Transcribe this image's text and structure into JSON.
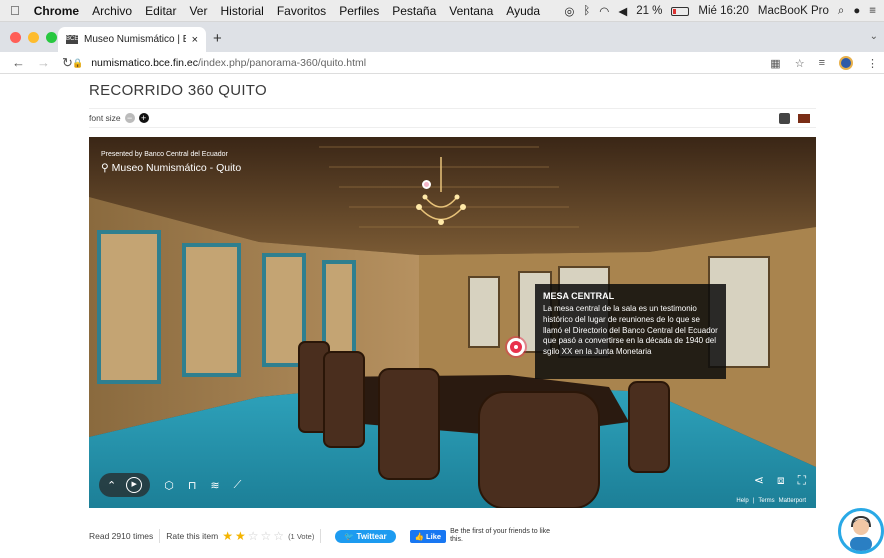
{
  "menubar": {
    "app": "Chrome",
    "items": [
      "Archivo",
      "Editar",
      "Ver",
      "Historial",
      "Favoritos",
      "Perfiles",
      "Pestaña",
      "Ventana",
      "Ayuda"
    ],
    "battery": "21 %",
    "battery_level": 0.21,
    "clock": "Mié 16:20",
    "device": "MacBooK Pro"
  },
  "tab": {
    "title": "Museo Numismático | BCE – Qu",
    "close": "×",
    "new": "+"
  },
  "address": {
    "host": "numismatico.bce.fin.ec",
    "path": "/index.php/panorama-360/quito.html"
  },
  "page": {
    "title": "RECORRIDO 360 QUITO",
    "font_size_label": "font size",
    "font_minus": "−",
    "font_plus": "+"
  },
  "viewer": {
    "presented_by": "Presented by Banco Central del Ecuador",
    "museum": "Museo Numismático - Quito",
    "tooltip_title": "MESA CENTRAL",
    "tooltip_body": "La mesa central de la sala es un testimonio histórico del lugar de reuniones de lo que se llamó el Directorio del Banco Central del Ecuador que pasó a convertirse en la década de 1940 del sgilo XX en la Junta Monetaria",
    "links": [
      "Help",
      "|",
      "Terms",
      "Matterport"
    ]
  },
  "footer": {
    "reads": "Read 2910 times",
    "rate_label": "Rate this item",
    "rating": 2,
    "rating_max": 5,
    "votes": "(1 Vote)",
    "tweet": "Twittear",
    "like": "Like",
    "like_message": "Be the first of your friends to like this."
  },
  "colors": {
    "accent_twitter": "#1d9bf0",
    "accent_facebook": "#1877f2",
    "hotspot": "#e8324d",
    "carpet": "#2a9bb5"
  }
}
